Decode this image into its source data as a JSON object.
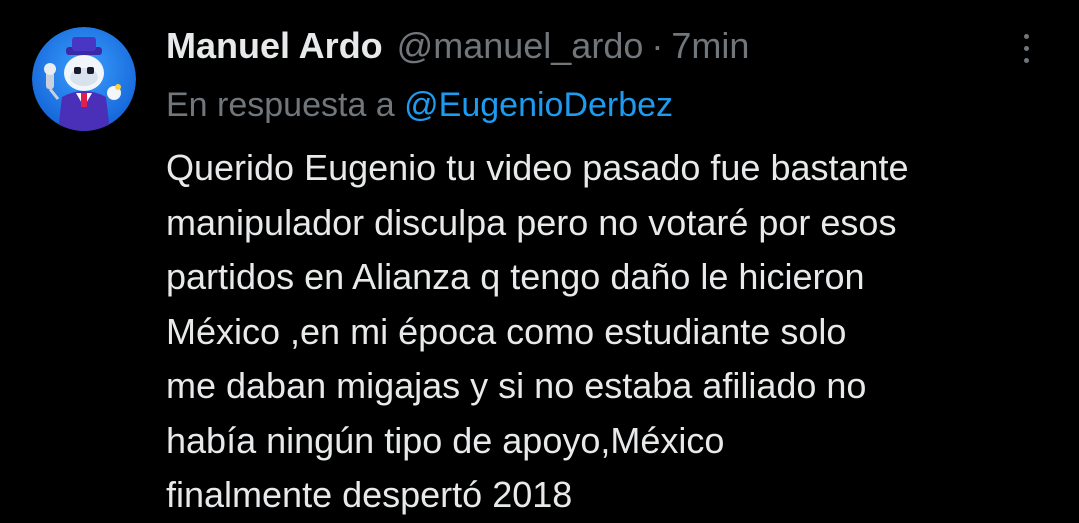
{
  "tweet": {
    "author": {
      "display_name": "Manuel Ardo",
      "handle": "@manuel_ardo",
      "avatar_icon": "robot-mascot-avatar"
    },
    "separator": "·",
    "time_ago": "7min",
    "reply": {
      "prefix": "En respuesta a",
      "mention": "@EugenioDerbez"
    },
    "body_lines": [
      "Querido Eugenio tu video pasado fue bastante",
      "manipulador disculpa pero no votaré por esos",
      "partidos en Alianza q tengo daño le hicieron",
      "México ,en mi época como estudiante solo",
      "me daban migajas y si no estaba afiliado no",
      "había ningún tipo de apoyo,México",
      "finalmente despertó 2018"
    ],
    "more_menu_icon": "more-vertical-icon"
  },
  "colors": {
    "background": "#000000",
    "primary_text": "#e7e9ea",
    "secondary_text": "#71767b",
    "link": "#1d9bf0",
    "avatar_bg": "#1d7fe0"
  }
}
